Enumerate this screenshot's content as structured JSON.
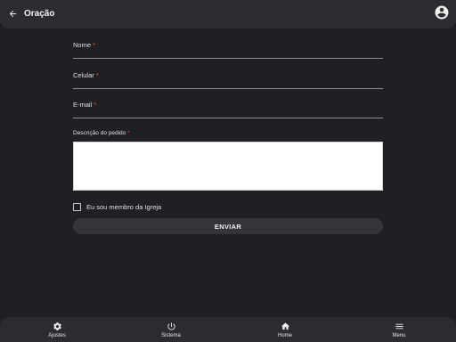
{
  "header": {
    "title": "Oração",
    "back_icon": "arrow-left-icon",
    "account_icon": "account-circle-icon"
  },
  "form": {
    "name_label": "Nome",
    "phone_label": "Celular",
    "email_label": "E-mail",
    "description_label": "Descrição do pedido",
    "required_mark": "*",
    "description_value": "",
    "member_checkbox_label": "Eu sou membro da Igreja",
    "member_checked": false,
    "submit_label": "ENVIAR"
  },
  "bottom_nav": {
    "items": [
      {
        "label": "Ajustes",
        "icon": "gear-icon"
      },
      {
        "label": "Sistema",
        "icon": "power-icon"
      },
      {
        "label": "Home",
        "icon": "home-icon"
      },
      {
        "label": "Menu",
        "icon": "hamburger-menu-icon"
      }
    ]
  },
  "colors": {
    "background": "#1f2024",
    "bar": "#2b2c31",
    "required": "#e0524f",
    "button": "#34353a"
  }
}
